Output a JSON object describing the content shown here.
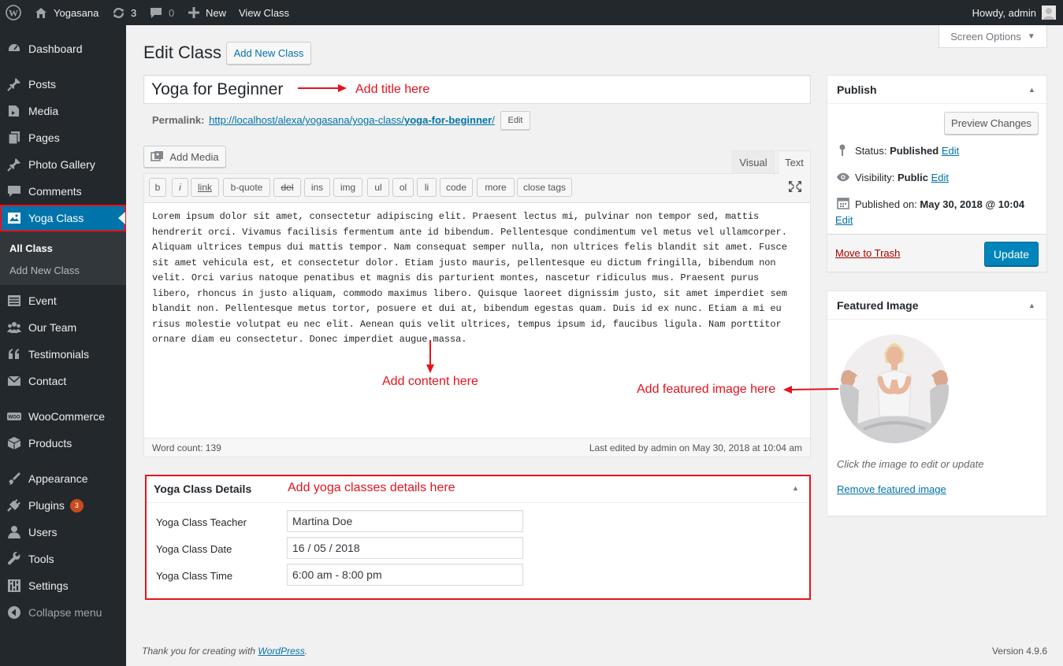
{
  "adminbar": {
    "site_name": "Yogasana",
    "updates_count": "3",
    "comments_count": "0",
    "new_label": "New",
    "view_label": "View Class",
    "howdy": "Howdy, admin"
  },
  "sidebar": {
    "items": [
      {
        "label": "Dashboard",
        "icon": "dashboard-icon"
      },
      {
        "label": "Posts",
        "icon": "pushpin-icon"
      },
      {
        "label": "Media",
        "icon": "media-icon"
      },
      {
        "label": "Pages",
        "icon": "pages-icon"
      },
      {
        "label": "Photo Gallery",
        "icon": "pushpin-icon"
      },
      {
        "label": "Comments",
        "icon": "comment-icon"
      },
      {
        "label": "Yoga Class",
        "icon": "image-icon"
      },
      {
        "label": "Event",
        "icon": "list-icon"
      },
      {
        "label": "Our Team",
        "icon": "team-icon"
      },
      {
        "label": "Testimonials",
        "icon": "quote-icon"
      },
      {
        "label": "Contact",
        "icon": "mail-icon"
      },
      {
        "label": "WooCommerce",
        "icon": "woo-icon"
      },
      {
        "label": "Products",
        "icon": "box-icon"
      },
      {
        "label": "Appearance",
        "icon": "brush-icon"
      },
      {
        "label": "Plugins",
        "icon": "plug-icon",
        "badge": "3"
      },
      {
        "label": "Users",
        "icon": "user-icon"
      },
      {
        "label": "Tools",
        "icon": "wrench-icon"
      },
      {
        "label": "Settings",
        "icon": "settings-icon"
      },
      {
        "label": "Collapse menu",
        "icon": "collapse-icon"
      }
    ],
    "submenu": [
      "All Class",
      "Add New Class"
    ]
  },
  "header": {
    "title": "Edit Class",
    "add_new": "Add New Class",
    "screen_options": "Screen Options"
  },
  "post": {
    "title": "Yoga for Beginner",
    "permalink_label": "Permalink:",
    "permalink_base": "http://localhost/alexa/yogasana/yoga-class/",
    "permalink_slug": "yoga-for-beginner",
    "permalink_end": "/",
    "edit_label": "Edit"
  },
  "editor": {
    "add_media": "Add Media",
    "tab_visual": "Visual",
    "tab_text": "Text",
    "quicktags": [
      "b",
      "i",
      "link",
      "b-quote",
      "del",
      "ins",
      "img",
      "ul",
      "ol",
      "li",
      "code",
      "more",
      "close tags"
    ],
    "content": "Lorem ipsum dolor sit amet, consectetur adipiscing elit. Praesent lectus mi, pulvinar non tempor sed, mattis hendrerit orci. Vivamus facilisis fermentum ante id bibendum. Pellentesque condimentum vel metus vel ullamcorper. Aliquam ultrices tempus dui mattis tempor. Nam consequat semper nulla, non ultrices felis blandit sit amet. Fusce sit amet vehicula est, et consectetur dolor. Etiam justo mauris, pellentesque eu dictum fringilla, bibendum non velit. Orci varius natoque penatibus et magnis dis parturient montes, nascetur ridiculus mus. Praesent purus libero, rhoncus in justo aliquam, commodo maximus libero. Quisque laoreet dignissim justo, sit amet imperdiet sem blandit non. Pellentesque metus tortor, posuere et dui at, bibendum egestas quam. Duis id ex nunc. Etiam a mi eu risus molestie volutpat eu nec elit. Aenean quis velit ultrices, tempus ipsum id, faucibus ligula. Nam porttitor ornare diam eu consectetur. Donec imperdiet augue massa.",
    "word_count": "Word count: 139",
    "last_edited": "Last edited by admin on May 30, 2018 at 10:04 am"
  },
  "annotations": {
    "title": "Add title here",
    "content": "Add content here",
    "featured": "Add featured image here",
    "details": "Add yoga classes details here"
  },
  "details": {
    "title": "Yoga Class Details",
    "fields": [
      {
        "label": "Yoga Class Teacher",
        "value": "Martina Doe"
      },
      {
        "label": "Yoga Class Date",
        "value": "16 / 05 / 2018"
      },
      {
        "label": "Yoga Class Time",
        "value": "6:00 am - 8:00 pm"
      }
    ]
  },
  "publish": {
    "title": "Publish",
    "preview": "Preview Changes",
    "status_label": "Status:",
    "status_value": "Published",
    "visibility_label": "Visibility:",
    "visibility_value": "Public",
    "published_label": "Published on:",
    "published_value": "May 30, 2018 @ 10:04",
    "edit": "Edit",
    "trash": "Move to Trash",
    "update": "Update"
  },
  "featured": {
    "title": "Featured Image",
    "hint": "Click the image to edit or update",
    "remove": "Remove featured image"
  },
  "footer": {
    "thanks_prefix": "Thank you for creating with ",
    "wordpress": "WordPress",
    "thanks_suffix": ".",
    "version": "Version 4.9.6"
  },
  "colors": {
    "accent": "#0073aa",
    "annotation_red": "#e3141e",
    "sidebar_bg": "#23282d",
    "update_button": "#0085ba"
  }
}
